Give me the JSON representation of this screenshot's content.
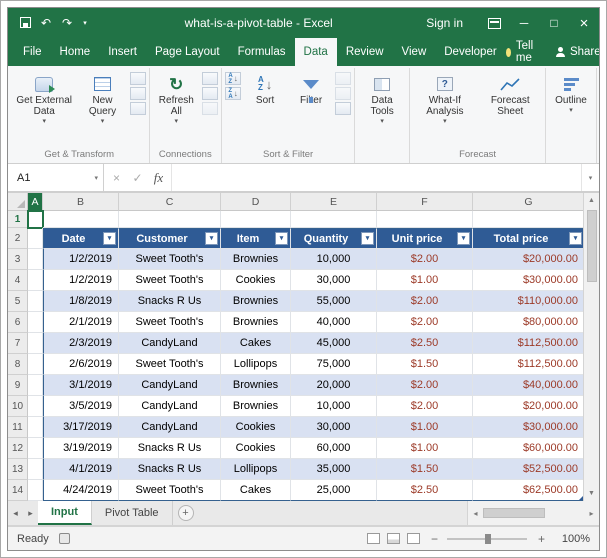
{
  "window": {
    "title": "what-is-a-pivot-table - Excel",
    "sign_in": "Sign in"
  },
  "ribbon_tabs": {
    "tabs": [
      "File",
      "Home",
      "Insert",
      "Page Layout",
      "Formulas",
      "Data",
      "Review",
      "View",
      "Developer"
    ],
    "active": "Data",
    "tell_me": "Tell me",
    "share": "Share"
  },
  "ribbon": {
    "get_external": "Get External Data",
    "new_query": "New Query",
    "refresh_all": "Refresh All",
    "sort": "Sort",
    "filter": "Filter",
    "data_tools": "Data Tools",
    "what_if": "What-If Analysis",
    "forecast_sheet": "Forecast Sheet",
    "outline": "Outline",
    "group_get_transform": "Get & Transform",
    "group_connections": "Connections",
    "group_sort_filter": "Sort & Filter",
    "group_forecast": "Forecast"
  },
  "formula_bar": {
    "name_box": "A1",
    "formula": ""
  },
  "sheet": {
    "columns": [
      "A",
      "B",
      "C",
      "D",
      "E",
      "F",
      "G"
    ],
    "row_numbers": [
      "1",
      "2",
      "3",
      "4",
      "5",
      "6",
      "7",
      "8",
      "9",
      "10",
      "11",
      "12",
      "13",
      "14"
    ],
    "table": {
      "headers": [
        "Date",
        "Customer",
        "Item",
        "Quantity",
        "Unit price",
        "Total price"
      ],
      "rows": [
        [
          "1/2/2019",
          "Sweet Tooth's",
          "Brownies",
          "10,000",
          "$2.00",
          "$20,000.00"
        ],
        [
          "1/2/2019",
          "Sweet Tooth's",
          "Cookies",
          "30,000",
          "$1.00",
          "$30,000.00"
        ],
        [
          "1/8/2019",
          "Snacks R Us",
          "Brownies",
          "55,000",
          "$2.00",
          "$110,000.00"
        ],
        [
          "2/1/2019",
          "Sweet Tooth's",
          "Brownies",
          "40,000",
          "$2.00",
          "$80,000.00"
        ],
        [
          "2/3/2019",
          "CandyLand",
          "Cakes",
          "45,000",
          "$2.50",
          "$112,500.00"
        ],
        [
          "2/6/2019",
          "Sweet Tooth's",
          "Lollipops",
          "75,000",
          "$1.50",
          "$112,500.00"
        ],
        [
          "3/1/2019",
          "CandyLand",
          "Brownies",
          "20,000",
          "$2.00",
          "$40,000.00"
        ],
        [
          "3/5/2019",
          "CandyLand",
          "Brownies",
          "10,000",
          "$2.00",
          "$20,000.00"
        ],
        [
          "3/17/2019",
          "CandyLand",
          "Cookies",
          "30,000",
          "$1.00",
          "$30,000.00"
        ],
        [
          "3/19/2019",
          "Snacks R Us",
          "Cookies",
          "60,000",
          "$1.00",
          "$60,000.00"
        ],
        [
          "4/1/2019",
          "Snacks R Us",
          "Lollipops",
          "35,000",
          "$1.50",
          "$52,500.00"
        ],
        [
          "4/24/2019",
          "Sweet Tooth's",
          "Cakes",
          "25,000",
          "$2.50",
          "$62,500.00"
        ]
      ]
    }
  },
  "sheet_tabs": [
    "Input",
    "Pivot Table"
  ],
  "status": {
    "mode": "Ready",
    "zoom": "100%"
  },
  "colors": {
    "excel_green": "#217346",
    "table_header_bg": "#2F5B95",
    "band_row_bg": "#D9E1F2",
    "price_text": "#9C3A28"
  },
  "icons": {
    "caret_down": "▾",
    "undo": "↶",
    "redo": "↷",
    "minimize": "─",
    "maximize": "□",
    "close": "×",
    "cancel": "×",
    "check": "✓",
    "fx": "fx",
    "refresh": "↻",
    "scroll_up": "▲",
    "scroll_down": "▼",
    "scroll_left": "◂",
    "scroll_right": "▸",
    "plus": "+",
    "minus": "−",
    "letter_a": "A",
    "letter_z": "Z",
    "arrow_down": "↓",
    "question": "?"
  }
}
